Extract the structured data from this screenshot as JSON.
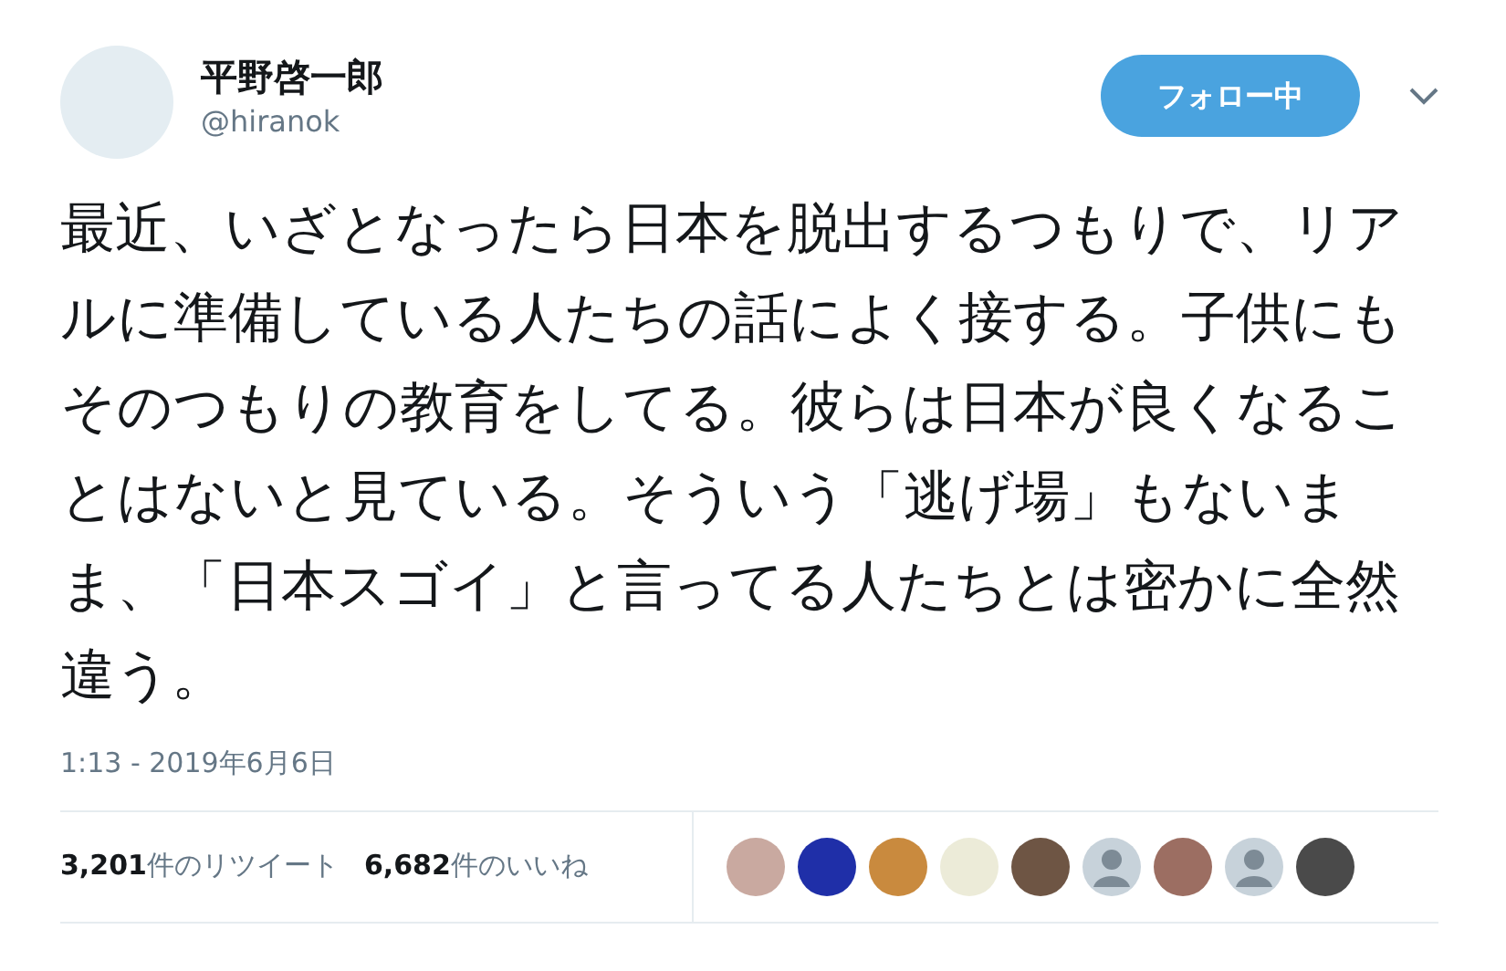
{
  "author": {
    "name": "平野啓一郎",
    "handle": "@hiranok"
  },
  "follow_button": {
    "label": "フォロー中",
    "following": true
  },
  "tweet_text": "最近、いざとなったら日本を脱出するつもりで、リアルに準備している人たちの話によく接する。子供にもそのつもりの教育をしてる。彼らは日本が良くなることはないと見ている。そういう「逃げ場」もないまま、「日本スゴイ」と言ってる人たちとは密かに全然違う。",
  "timestamp": "1:13 - 2019年6月6日",
  "stats": [
    {
      "count": "3,201",
      "label": "件のリツイート"
    },
    {
      "count": "6,682",
      "label": "件のいいね"
    }
  ],
  "likers": [
    {
      "kind": "photo",
      "color": "#c9a9a0"
    },
    {
      "kind": "photo",
      "color": "#1f2fa8"
    },
    {
      "kind": "photo",
      "color": "#c98a3e"
    },
    {
      "kind": "photo",
      "color": "#ecebd8"
    },
    {
      "kind": "photo",
      "color": "#6e5544"
    },
    {
      "kind": "default",
      "color": "#c7d2da"
    },
    {
      "kind": "photo",
      "color": "#9c6e62"
    },
    {
      "kind": "default",
      "color": "#c7d2da"
    },
    {
      "kind": "photo",
      "color": "#4a4a4a"
    }
  ]
}
